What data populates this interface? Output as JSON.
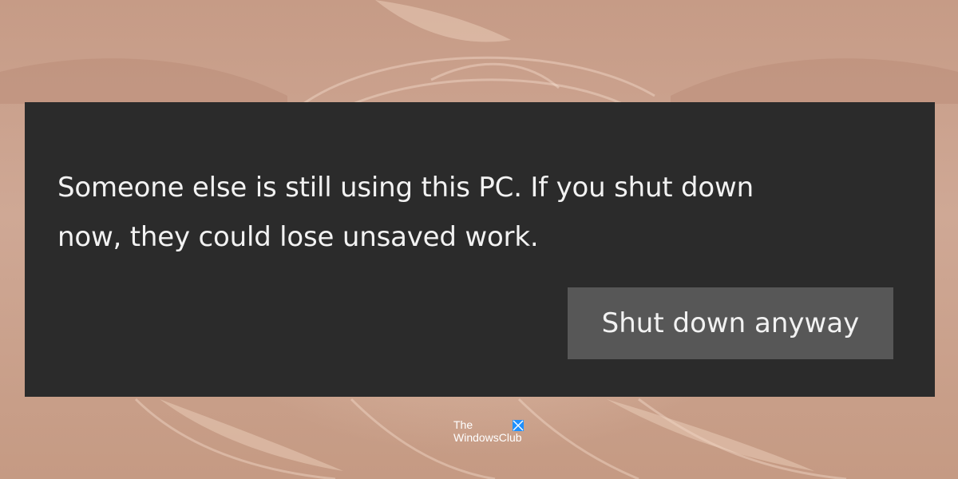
{
  "dialog": {
    "message": "Someone else is still using this PC. If you shut down\nnow, they could lose unsaved work.",
    "button_label": "Shut down anyway"
  },
  "watermark": {
    "line1": "The",
    "line2": "WindowsClub",
    "logo_icon": "windows-logo-icon"
  },
  "colors": {
    "dialog_background": "#2b2b2b",
    "button_background": "#575757",
    "text": "#f2f2f2",
    "wallpaper": "#c9a38e",
    "logo": "#1e90ff"
  }
}
